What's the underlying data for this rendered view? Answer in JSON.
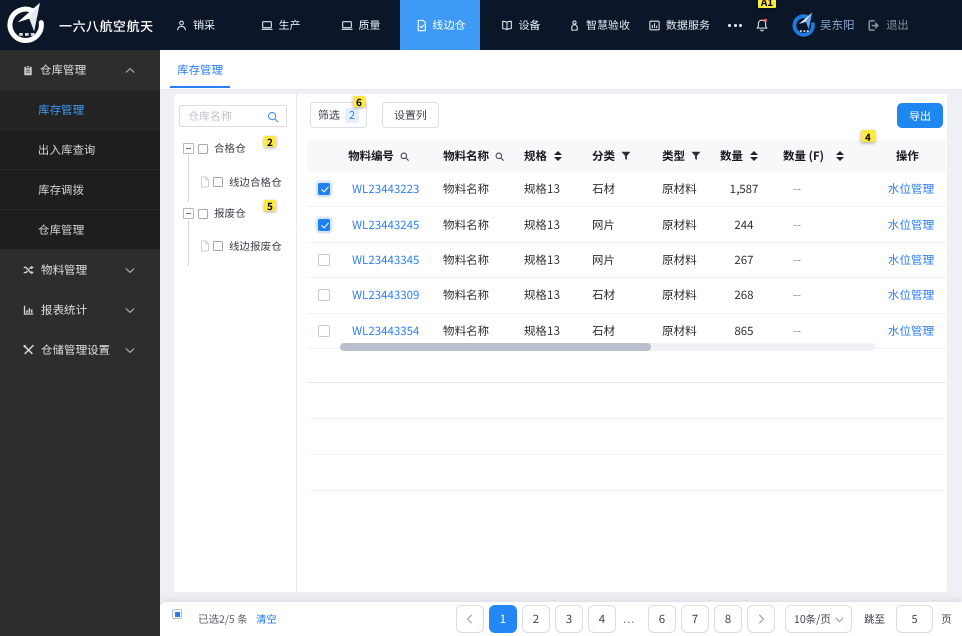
{
  "topbar": {
    "brand": "一六八航空航天",
    "nav": [
      {
        "label": "销采",
        "icon": "person-icon",
        "active": false
      },
      {
        "label": "生产",
        "icon": "laptop-icon",
        "active": false
      },
      {
        "label": "质量",
        "icon": "laptop-icon",
        "active": false
      },
      {
        "label": "线边仓",
        "icon": "document-check-icon",
        "active": true
      },
      {
        "label": "设备",
        "icon": "book-icon",
        "active": false
      },
      {
        "label": "智慧验收",
        "icon": "person-check-icon",
        "active": false
      },
      {
        "label": "数据服务",
        "icon": "chart-box-icon",
        "active": false
      }
    ],
    "more": "...",
    "user_name": "吴东阳",
    "logout_label": "退出",
    "active_color": "#3d9af5"
  },
  "sidebar": {
    "groups": [
      {
        "label": "仓库管理",
        "icon": "clipboard-icon",
        "expanded": true,
        "children": [
          {
            "label": "库存管理",
            "active": true
          },
          {
            "label": "出入库查询",
            "active": false
          },
          {
            "label": "库存调拨",
            "active": false
          },
          {
            "label": "仓库管理",
            "active": false
          }
        ]
      },
      {
        "label": "物料管理",
        "icon": "shuffle-icon",
        "expanded": false,
        "children": []
      },
      {
        "label": "报表统计",
        "icon": "bar-chart-icon",
        "expanded": false,
        "children": []
      },
      {
        "label": "仓储管理设置",
        "icon": "tools-icon",
        "expanded": false,
        "children": []
      }
    ]
  },
  "tabs": [
    {
      "label": "库存管理",
      "active": true
    }
  ],
  "tree": {
    "search_placeholder": "仓库名称",
    "nodes": [
      {
        "label": "合格仓",
        "type": "parent",
        "annotation": "2"
      },
      {
        "label": "线边合格仓",
        "type": "child"
      },
      {
        "label": "报废仓",
        "type": "parent",
        "annotation": "5"
      },
      {
        "label": "线边报废仓",
        "type": "child"
      }
    ]
  },
  "toolbar": {
    "filter_label": "筛选",
    "filter_count": "2",
    "filter_annotation": "6",
    "columns_label": "设置列",
    "export_label": "导出"
  },
  "table": {
    "headers": [
      {
        "label": "物料编号",
        "icon": "search"
      },
      {
        "label": "物料名称",
        "icon": "search"
      },
      {
        "label": "规格",
        "icon": "sort"
      },
      {
        "label": "分类",
        "icon": "filter"
      },
      {
        "label": "类型",
        "icon": "filter"
      },
      {
        "label": "数量",
        "icon": "sort"
      },
      {
        "label": "数量 (F)",
        "icon": "sort",
        "annotation": "4"
      },
      {
        "label": "操作",
        "icon": ""
      }
    ],
    "rows": [
      {
        "checked": true,
        "code": "WL23443223",
        "name": "物料名称",
        "spec": "规格13",
        "category": "石材",
        "type": "原材料",
        "qty": "1,587",
        "qty_f": "--",
        "action": "水位管理"
      },
      {
        "checked": true,
        "code": "WL23443245",
        "name": "物料名称",
        "spec": "规格13",
        "category": "网片",
        "type": "原材料",
        "qty": "244",
        "qty_f": "--",
        "action": "水位管理"
      },
      {
        "checked": false,
        "code": "WL23443345",
        "name": "物料名称",
        "spec": "规格13",
        "category": "网片",
        "type": "原材料",
        "qty": "267",
        "qty_f": "--",
        "action": "水位管理"
      },
      {
        "checked": false,
        "code": "WL23443309",
        "name": "物料名称",
        "spec": "规格13",
        "category": "石材",
        "type": "原材料",
        "qty": "268",
        "qty_f": "--",
        "action": "水位管理"
      },
      {
        "checked": false,
        "code": "WL23443354",
        "name": "物料名称",
        "spec": "规格13",
        "category": "石材",
        "type": "原材料",
        "qty": "865",
        "qty_f": "--",
        "action": "水位管理"
      }
    ]
  },
  "footer": {
    "selected_text": "已选2/5 条",
    "clear_label": "清空",
    "pages": [
      "1",
      "2",
      "3",
      "4",
      "...",
      "6",
      "7",
      "8"
    ],
    "active_page": "1",
    "page_size": "10条/页",
    "jump_label": "跳至",
    "jump_value": "5",
    "page_unit": "页"
  },
  "annotations": {
    "bell_badge": "A1"
  },
  "colors": {
    "topbar_bg": "#0b1628",
    "nav_active": "#3d9af5",
    "sidebar_bg": "#2d2d2d",
    "submenu_bg": "#1e1e1e",
    "link_blue": "#2f80f7",
    "primary_blue": "#2080f0",
    "annotation_yellow": "#ffe93e",
    "content_bg": "#eef0f4"
  }
}
